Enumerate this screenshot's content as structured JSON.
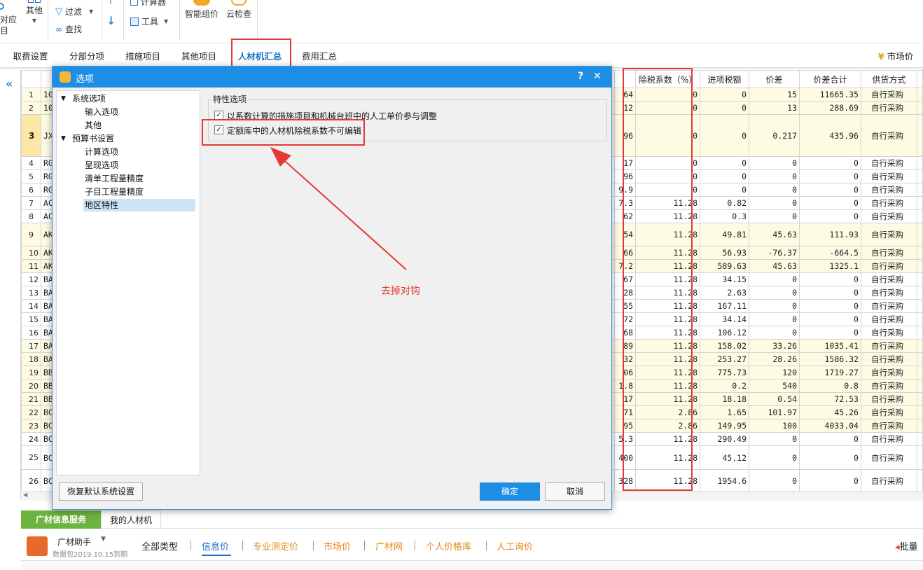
{
  "toolbar": {
    "partial_left_top": "对应",
    "partial_left_bottom": "目",
    "other": "其他",
    "filter": "过滤",
    "find": "查找",
    "calculator_partial": "计算器",
    "tools": "工具",
    "smart_pricing": "智能组价",
    "cloud_check": "云检查"
  },
  "tabs": [
    "取费设置",
    "分部分项",
    "措施项目",
    "其他项目",
    "人材机汇总",
    "费用汇总"
  ],
  "active_tab": "人材机汇总",
  "market_price_partial": "市场价",
  "grid": {
    "headers": [
      "除税系数（%）",
      "进项税额",
      "价差",
      "价差合计",
      "供货方式"
    ],
    "rows": [
      {
        "n": "1",
        "code": "10",
        "c": "64",
        "tax": "0",
        "input_tax": "0",
        "diff": "15",
        "diff_total": "11665.35",
        "supply": "自行采购",
        "h": 19,
        "y": true
      },
      {
        "n": "2",
        "code": "10",
        "c": "12",
        "tax": "0",
        "input_tax": "0",
        "diff": "13",
        "diff_total": "288.69",
        "supply": "自行采购",
        "h": 19,
        "y": true
      },
      {
        "n": "3",
        "code": "JX",
        "c": "96",
        "tax": "0",
        "input_tax": "0",
        "diff": "0.217",
        "diff_total": "435.96",
        "supply": "自行采购",
        "h": 60,
        "y": true,
        "sel": true
      },
      {
        "n": "4",
        "code": "RG",
        "c": "17",
        "tax": "0",
        "input_tax": "0",
        "diff": "0",
        "diff_total": "0",
        "supply": "自行采购",
        "h": 19,
        "y": false
      },
      {
        "n": "5",
        "code": "RG",
        "c": "96",
        "tax": "0",
        "input_tax": "0",
        "diff": "0",
        "diff_total": "0",
        "supply": "自行采购",
        "h": 19,
        "y": false
      },
      {
        "n": "6",
        "code": "RG",
        "c": "9.9",
        "tax": "0",
        "input_tax": "0",
        "diff": "0",
        "diff_total": "0",
        "supply": "自行采购",
        "h": 19,
        "y": false
      },
      {
        "n": "7",
        "code": "AC",
        "c": "7.3",
        "tax": "11.28",
        "input_tax": "0.82",
        "diff": "0",
        "diff_total": "0",
        "supply": "自行采购",
        "h": 19,
        "y": false
      },
      {
        "n": "8",
        "code": "AC",
        "c": "62",
        "tax": "11.28",
        "input_tax": "0.3",
        "diff": "0",
        "diff_total": "0",
        "supply": "自行采购",
        "h": 19,
        "y": false
      },
      {
        "n": "9",
        "code": "AK",
        "c": "54",
        "tax": "11.28",
        "input_tax": "49.81",
        "diff": "45.63",
        "diff_total": "111.93",
        "supply": "自行采购",
        "h": 33,
        "y": true
      },
      {
        "n": "10",
        "code": "AK",
        "c": "66",
        "tax": "11.28",
        "input_tax": "56.93",
        "diff": "-76.37",
        "diff_total": "-664.5",
        "supply": "自行采购",
        "h": 19,
        "y": true
      },
      {
        "n": "11",
        "code": "AK",
        "c": "7.2",
        "tax": "11.28",
        "input_tax": "589.63",
        "diff": "45.63",
        "diff_total": "1325.1",
        "supply": "自行采购",
        "h": 19,
        "y": true
      },
      {
        "n": "12",
        "code": "BA",
        "c": "67",
        "tax": "11.28",
        "input_tax": "34.15",
        "diff": "0",
        "diff_total": "0",
        "supply": "自行采购",
        "h": 19,
        "y": false
      },
      {
        "n": "13",
        "code": "BA",
        "c": "28",
        "tax": "11.28",
        "input_tax": "2.63",
        "diff": "0",
        "diff_total": "0",
        "supply": "自行采购",
        "h": 19,
        "y": false
      },
      {
        "n": "14",
        "code": "BA",
        "c": "55",
        "tax": "11.28",
        "input_tax": "167.11",
        "diff": "0",
        "diff_total": "0",
        "supply": "自行采购",
        "h": 19,
        "y": false
      },
      {
        "n": "15",
        "code": "BA",
        "c": "72",
        "tax": "11.28",
        "input_tax": "34.14",
        "diff": "0",
        "diff_total": "0",
        "supply": "自行采购",
        "h": 19,
        "y": false
      },
      {
        "n": "16",
        "code": "BA",
        "c": "68",
        "tax": "11.28",
        "input_tax": "106.12",
        "diff": "0",
        "diff_total": "0",
        "supply": "自行采购",
        "h": 19,
        "y": false
      },
      {
        "n": "17",
        "code": "BA",
        "c": "89",
        "tax": "11.28",
        "input_tax": "158.02",
        "diff": "33.26",
        "diff_total": "1035.41",
        "supply": "自行采购",
        "h": 19,
        "y": true
      },
      {
        "n": "18",
        "code": "BA",
        "c": "32",
        "tax": "11.28",
        "input_tax": "253.27",
        "diff": "28.26",
        "diff_total": "1586.32",
        "supply": "自行采购",
        "h": 19,
        "y": true
      },
      {
        "n": "19",
        "code": "BB",
        "c": "06",
        "tax": "11.28",
        "input_tax": "775.73",
        "diff": "120",
        "diff_total": "1719.27",
        "supply": "自行采购",
        "h": 19,
        "y": true
      },
      {
        "n": "20",
        "code": "BB",
        "c": "1.8",
        "tax": "11.28",
        "input_tax": "0.2",
        "diff": "540",
        "diff_total": "0.8",
        "supply": "自行采购",
        "h": 19,
        "y": true
      },
      {
        "n": "21",
        "code": "BB",
        "c": "17",
        "tax": "11.28",
        "input_tax": "18.18",
        "diff": "0.54",
        "diff_total": "72.53",
        "supply": "自行采购",
        "h": 19,
        "y": true
      },
      {
        "n": "22",
        "code": "BC",
        "c": "71",
        "tax": "2.86",
        "input_tax": "1.65",
        "diff": "101.97",
        "diff_total": "45.26",
        "supply": "自行采购",
        "h": 19,
        "y": true
      },
      {
        "n": "23",
        "code": "BC",
        "c": "95",
        "tax": "2.86",
        "input_tax": "149.95",
        "diff": "100",
        "diff_total": "4033.04",
        "supply": "自行采购",
        "h": 19,
        "y": true
      },
      {
        "n": "24",
        "code": "BC",
        "c": "5.3",
        "tax": "11.28",
        "input_tax": "290.49",
        "diff": "0",
        "diff_total": "0",
        "supply": "自行采购",
        "h": 19,
        "y": false
      },
      {
        "n": "25",
        "code": "BC",
        "c": "400",
        "tax": "11.28",
        "input_tax": "45.12",
        "diff": "0",
        "diff_total": "0",
        "supply": "自行采购",
        "h": 34,
        "y": false
      },
      {
        "n": "26",
        "code": "BC",
        "c": "328",
        "tax": "11.28",
        "input_tax": "1954.6",
        "diff": "0",
        "diff_total": "0",
        "supply": "自行采购",
        "h": 33,
        "y": false
      }
    ]
  },
  "dialog": {
    "title": "选项",
    "help": "?",
    "close": "✕",
    "tree": [
      {
        "label": "系统选项",
        "level": 0,
        "expanded": true
      },
      {
        "label": "输入选项",
        "level": 1
      },
      {
        "label": "其他",
        "level": 1
      },
      {
        "label": "预算书设置",
        "level": 0,
        "expanded": true
      },
      {
        "label": "计算选项",
        "level": 1
      },
      {
        "label": "呈现选项",
        "level": 1
      },
      {
        "label": "清单工程量精度",
        "level": 1
      },
      {
        "label": "子目工程量精度",
        "level": 1
      },
      {
        "label": "地区特性",
        "level": 1,
        "selected": true
      }
    ],
    "group_title": "特性选项",
    "options": [
      {
        "label": "以系数计算的措施项目和机械台班中的人工单价参与调整",
        "checked": true
      },
      {
        "label": "定额库中的人材机除税系数不可编辑",
        "checked": true
      }
    ],
    "restore_button": "恢复默认系统设置",
    "ok_button": "确定",
    "cancel_button": "取消"
  },
  "annotation": "去掉对钩",
  "bottom": {
    "tab_service": "广材信息服务",
    "tab_my": "我的人材机",
    "assistant": "广材助手",
    "assistant_sub": "数据包2019.10.15到期",
    "links": [
      "全部类型",
      "信息价",
      "专业测定价",
      "市场价",
      "广材网",
      "个人价格库",
      "人工询价"
    ],
    "active_link": "信息价",
    "batch_partial": "批量"
  },
  "colors": {
    "accent": "#1e8ee4",
    "annotation_red": "#e53935",
    "active_tab": "#1a6fc9",
    "service_green": "#6cb33f",
    "link_orange": "#e58a1b"
  }
}
